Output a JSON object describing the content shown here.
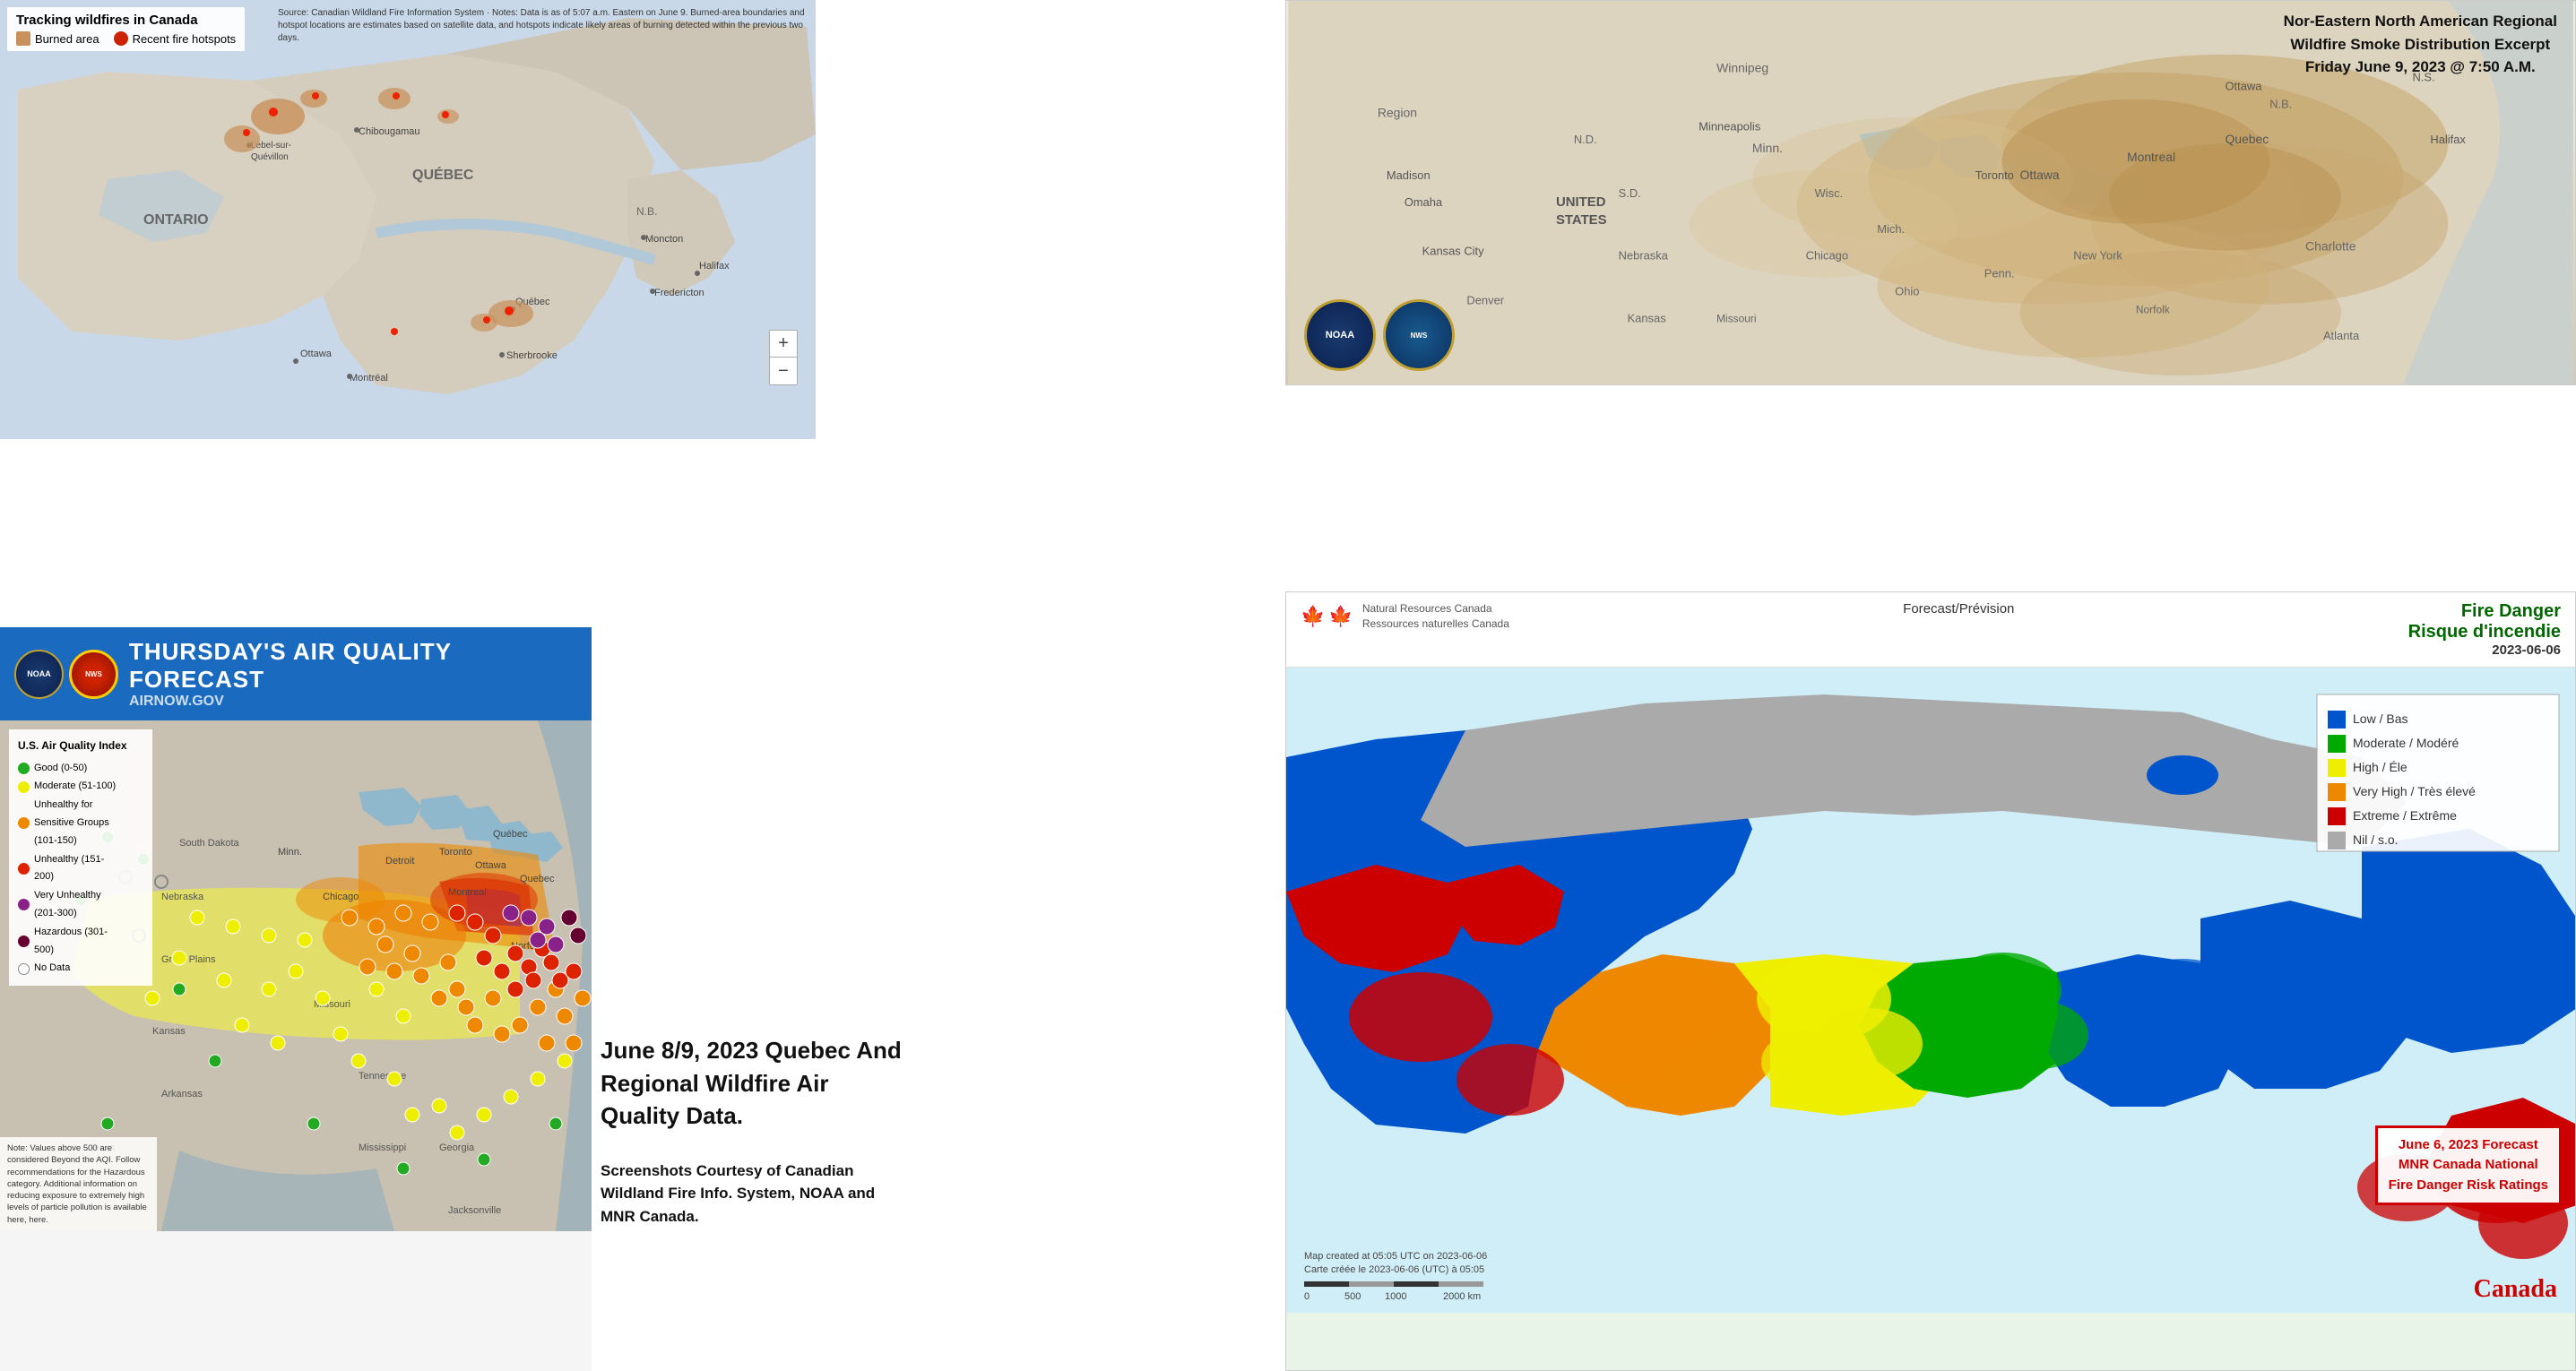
{
  "canadaMap": {
    "title": "Tracking wildfires in Canada",
    "legendBurnedLabel": "Burned area",
    "legendHotspotsLabel": "Recent fire hotspots",
    "burnedColor": "#c8a060",
    "hotspotsColor": "#cc2200",
    "sourceText": "Source: Canadian Wildland Fire Information System   ·   Notes: Data is as of 5:07 a.m. Eastern on June 9. Burned-area boundaries and hotspot locations are estimates based on satellite data, and hotspots indicate likely areas of burning detected within the previous two days.",
    "zoomIn": "+",
    "zoomOut": "−",
    "labels": [
      "ONTARIO",
      "QUÉBEC",
      "N.B.",
      "Ottawa",
      "Montreal",
      "Sherbrooke",
      "Québec",
      "Fredericton",
      "Halifax",
      "Moncton",
      "Chibougamau",
      "Lebel-sur-Quévillon"
    ]
  },
  "smokeMap": {
    "title": "Nor-Eastern North American Regional\nWildfire Smoke Distribution Excerpt\nFriday June 9, 2023 @ 7:50 A.M.",
    "noaaLabel": "NOAA",
    "weatherLabel": "NWS"
  },
  "aqForecast": {
    "mainTitle": "THURSDAY'S AIR QUALITY FORECAST",
    "subtitle": "AIRNOW.GOV",
    "legend": {
      "title": "U.S. Air Quality Index",
      "items": [
        {
          "label": "Good (0-50)",
          "color": "#22aa22"
        },
        {
          "label": "Moderate (51-100)",
          "color": "#dddd00"
        },
        {
          "label": "Unhealthy for Sensitive Groups (101-150)",
          "color": "#ee7700"
        },
        {
          "label": "Unhealthy (151-200)",
          "color": "#cc2200"
        },
        {
          "label": "Very Unhealthy (201-300)",
          "color": "#880088"
        },
        {
          "label": "Hazardous (301-500)",
          "color": "#660030"
        },
        {
          "label": "No Data",
          "color": "#ffffff",
          "outline": true
        }
      ]
    },
    "noteText": "Note: Values above 500 are considered Beyond the AQI. Follow recommendations for the Hazardous category. Additional information on reducing exposure to extremely high levels of particle pollution is available here, here."
  },
  "quebecCaption": {
    "title": "June 8/9, 2023 Quebec And Regional Wildfire Air Quality Data.",
    "credits": "Screenshots Courtesy of Canadian Wildland Fire Info. System, NOAA and MNR Canada."
  },
  "fireDanger": {
    "govLabel": "Natural Resources\nRessources naturelles\nCanada",
    "forecastLabel": "Forecast/Prévision",
    "titleRight": "Fire Danger\nRisque d'incendie",
    "date": "2023-06-06",
    "legend": {
      "items": [
        {
          "label": "Low / Bas",
          "color": "#0044cc"
        },
        {
          "label": "Moderate / Modéré",
          "color": "#00cc00"
        },
        {
          "label": "High / Éle",
          "color": "#eeee00"
        },
        {
          "label": "Very High / Très élevé",
          "color": "#ee8800"
        },
        {
          "label": "Extreme / Extrême",
          "color": "#cc0000"
        },
        {
          "label": "Nil / s.o.",
          "color": "#aaaaaa"
        }
      ]
    },
    "callout": "June 6, 2023 Forecast\nMNR Canada National\nFire Danger Risk Ratings",
    "canadaWordmark": "Canada",
    "scaleLabel": "0    500   1000        2000 km"
  }
}
